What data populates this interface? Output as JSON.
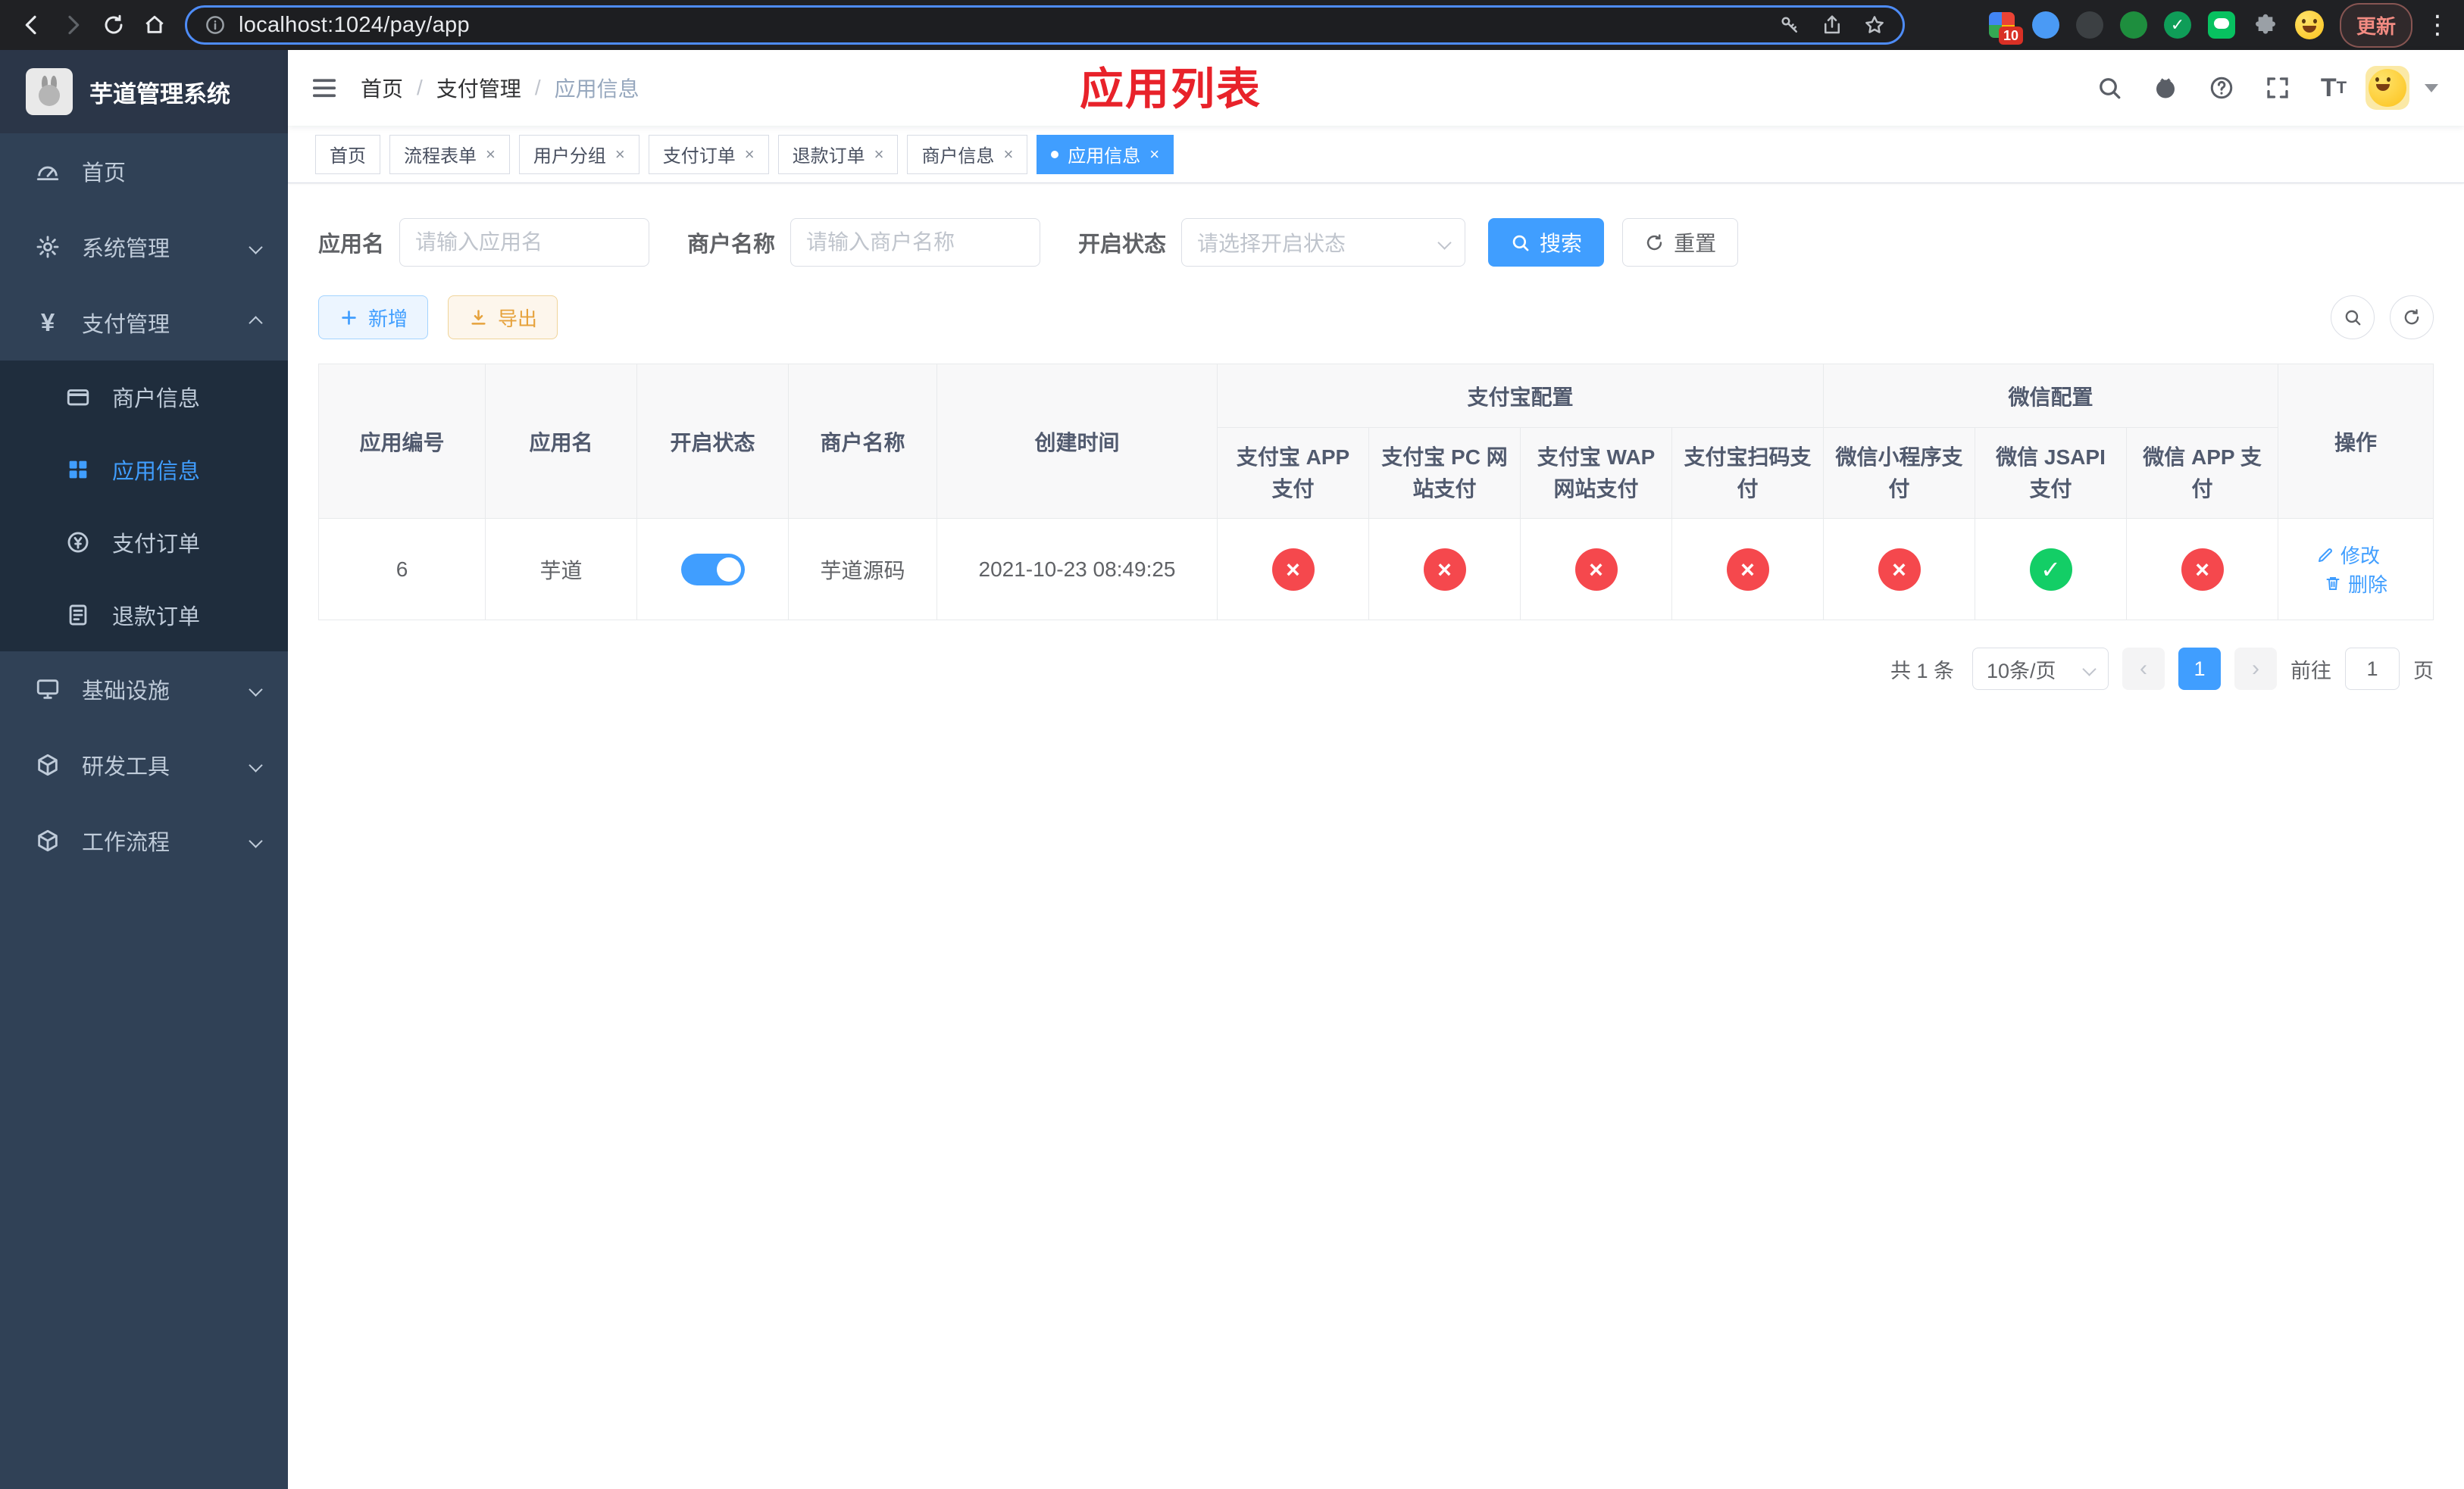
{
  "browser": {
    "url": "localhost:1024/pay/app",
    "update_label": "更新",
    "extension_badge": "10"
  },
  "sidebar": {
    "title": "芋道管理系统",
    "items": [
      {
        "label": "首页"
      },
      {
        "label": "系统管理"
      },
      {
        "label": "支付管理",
        "children": [
          {
            "label": "商户信息"
          },
          {
            "label": "应用信息",
            "active": true
          },
          {
            "label": "支付订单"
          },
          {
            "label": "退款订单"
          }
        ]
      },
      {
        "label": "基础设施"
      },
      {
        "label": "研发工具"
      },
      {
        "label": "工作流程"
      }
    ]
  },
  "navbar": {
    "breadcrumb": [
      "首页",
      "支付管理",
      "应用信息"
    ],
    "separator": "/",
    "annotation": "应用列表"
  },
  "tabs": [
    {
      "label": "首页",
      "closable": false,
      "active": false
    },
    {
      "label": "流程表单",
      "closable": true,
      "active": false
    },
    {
      "label": "用户分组",
      "closable": true,
      "active": false
    },
    {
      "label": "支付订单",
      "closable": true,
      "active": false
    },
    {
      "label": "退款订单",
      "closable": true,
      "active": false
    },
    {
      "label": "商户信息",
      "closable": true,
      "active": false
    },
    {
      "label": "应用信息",
      "closable": true,
      "active": true
    }
  ],
  "filters": {
    "app_name_label": "应用名",
    "app_name_placeholder": "请输入应用名",
    "merchant_label": "商户名称",
    "merchant_placeholder": "请输入商户名称",
    "status_label": "开启状态",
    "status_placeholder": "请选择开启状态",
    "search_button": "搜索",
    "reset_button": "重置"
  },
  "toolbar": {
    "add_button": "新增",
    "export_button": "导出"
  },
  "table": {
    "groups": {
      "alipay": "支付宝配置",
      "wechat": "微信配置"
    },
    "columns": {
      "id": "应用编号",
      "name": "应用名",
      "status": "开启状态",
      "merchant": "商户名称",
      "created": "创建时间",
      "alipay_app": "支付宝 APP 支付",
      "alipay_pc": "支付宝 PC 网站支付",
      "alipay_wap": "支付宝 WAP 网站支付",
      "alipay_scan": "支付宝扫码支付",
      "wx_mini": "微信小程序支付",
      "wx_jsapi": "微信 JSAPI 支付",
      "wx_app": "微信 APP 支付",
      "ops": "操作"
    },
    "rows": [
      {
        "id": "6",
        "name": "芋道",
        "enabled": true,
        "merchant": "芋道源码",
        "created": "2021-10-23 08:49:25",
        "alipay_app": false,
        "alipay_pc": false,
        "alipay_wap": false,
        "alipay_scan": false,
        "wx_mini": false,
        "wx_jsapi": true,
        "wx_app": false,
        "edit": "修改",
        "delete": "删除"
      }
    ]
  },
  "pagination": {
    "total": "共 1 条",
    "page_size": "10条/页",
    "current_page": "1",
    "goto_prefix": "前往",
    "goto_value": "1",
    "goto_suffix": "页"
  },
  "colors": {
    "accent": "#409eff",
    "success": "#13ce66",
    "danger": "#f5484d",
    "sidebar_bg": "#304156",
    "submenu_bg": "#1f2d3d",
    "annotation_red": "#e8222a"
  }
}
